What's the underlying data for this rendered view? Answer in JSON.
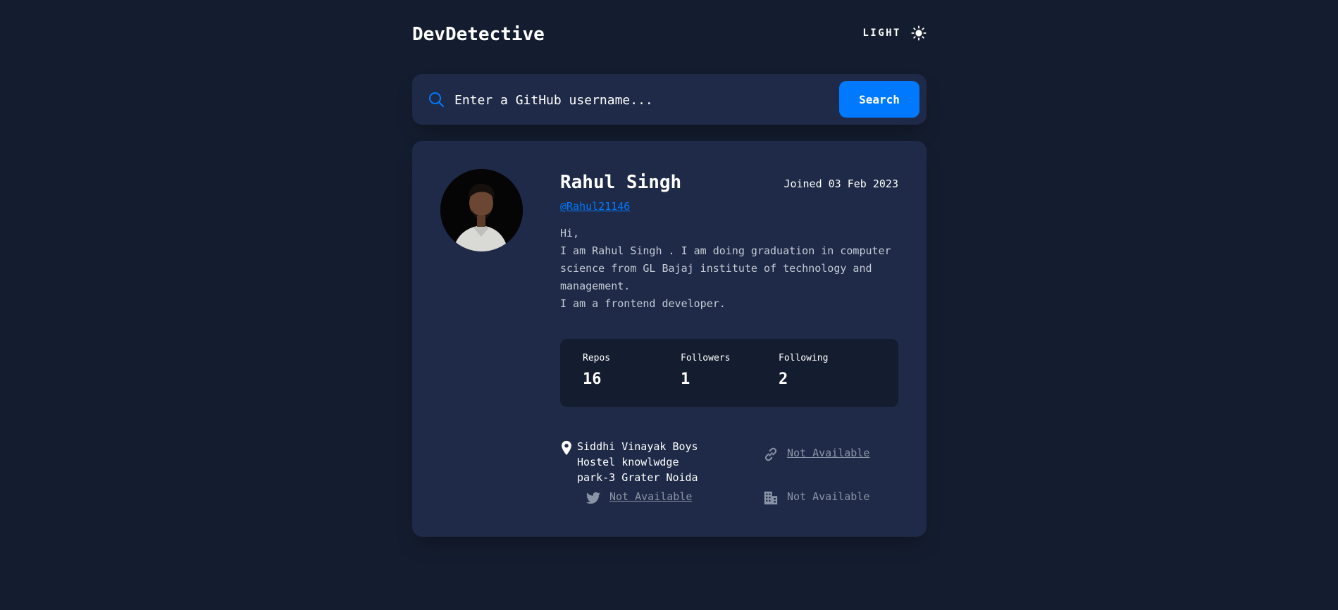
{
  "header": {
    "app_title": "DevDetective",
    "theme_label": "LIGHT",
    "theme_icon": "sun-icon"
  },
  "search": {
    "placeholder": "Enter a GitHub username...",
    "value": "",
    "button_label": "Search",
    "icon": "search-icon"
  },
  "profile": {
    "name": "Rahul Singh",
    "joined": "Joined 03 Feb 2023",
    "username": "@Rahul21146",
    "bio_lines": [
      "Hi,",
      "I am Rahul Singh . I am doing graduation in computer",
      "science from GL Bajaj institute of technology and",
      "management.",
      "I am a frontend developer."
    ],
    "stats": [
      {
        "label": "Repos",
        "value": "16"
      },
      {
        "label": "Followers",
        "value": "1"
      },
      {
        "label": "Following",
        "value": "2"
      }
    ],
    "location_lines": [
      "Siddhi Vinayak Boys",
      "Hostel knowlwdge",
      "park-3 Grater Noida"
    ],
    "website": "Not Available",
    "twitter": "Not Available",
    "company": "Not Available"
  },
  "colors": {
    "background": "#141d2f",
    "card": "#1e2a47",
    "accent": "#0079ff",
    "muted": "#8a94a7"
  }
}
